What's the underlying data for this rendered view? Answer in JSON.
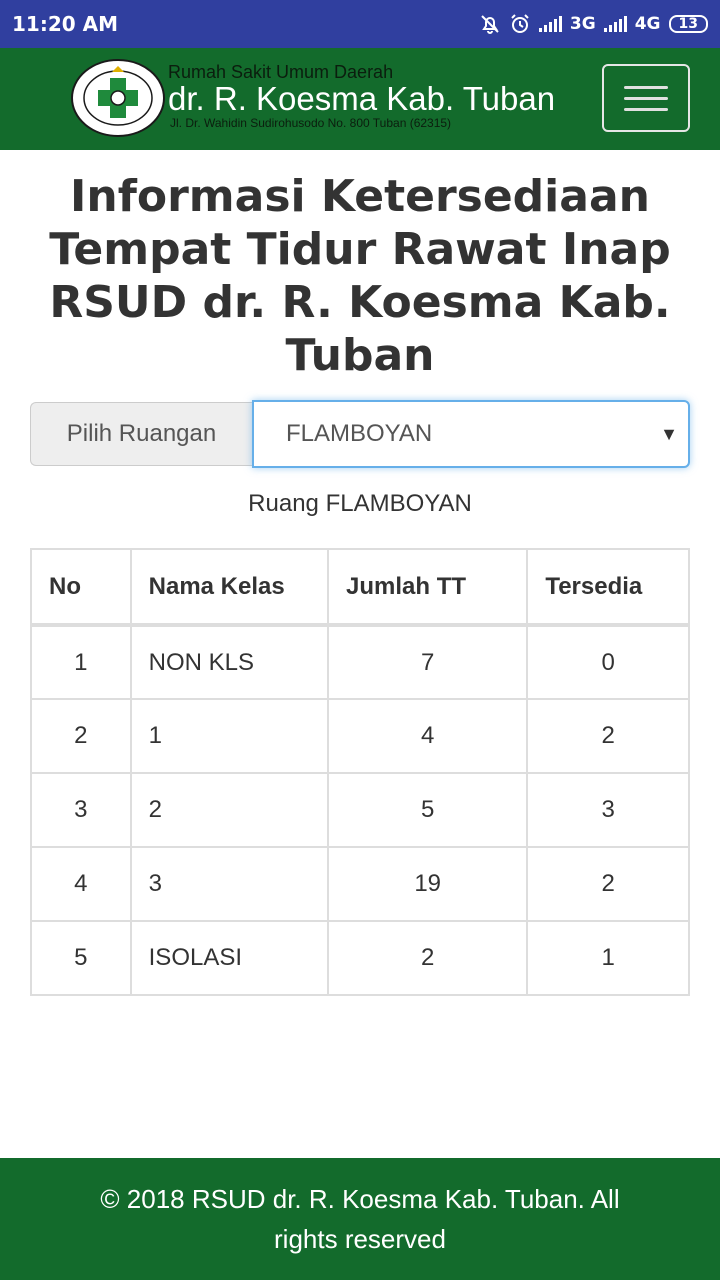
{
  "status_bar": {
    "time": "11:20 AM",
    "network_3g": "3G",
    "network_4g": "4G",
    "battery": "13",
    "icons": [
      "mute-bell-icon",
      "alarm-icon",
      "signal-icon",
      "battery-icon"
    ]
  },
  "header": {
    "org_line1": "Rumah Sakit Umum Daerah",
    "org_name": "dr. R. Koesma Kab. Tuban",
    "address": "Jl. Dr. Wahidin Sudirohusodo No. 800 Tuban (62315)",
    "logo_text": "RSUD dr. R. KOESMA TUBAN",
    "menu_icon": "hamburger-icon"
  },
  "page": {
    "title": "Informasi Ketersediaan Tempat Tidur Rawat Inap RSUD dr. R. Koesma Kab. Tuban",
    "select_label": "Pilih Ruangan",
    "selected_room": "FLAMBOYAN",
    "room_caption": "Ruang FLAMBOYAN"
  },
  "table": {
    "headers": [
      "No",
      "Nama Kelas",
      "Jumlah TT",
      "Tersedia"
    ],
    "rows": [
      [
        "1",
        "NON KLS",
        "7",
        "0"
      ],
      [
        "2",
        "1",
        "4",
        "2"
      ],
      [
        "3",
        "2",
        "5",
        "3"
      ],
      [
        "4",
        "3",
        "19",
        "2"
      ],
      [
        "5",
        "ISOLASI",
        "2",
        "1"
      ]
    ]
  },
  "footer": {
    "text": "© 2018 RSUD dr. R. Koesma Kab. Tuban. All rights reserved"
  },
  "colors": {
    "status_bar": "#303f9f",
    "brand_green": "#136b2c",
    "focus_blue": "#66afe9"
  }
}
